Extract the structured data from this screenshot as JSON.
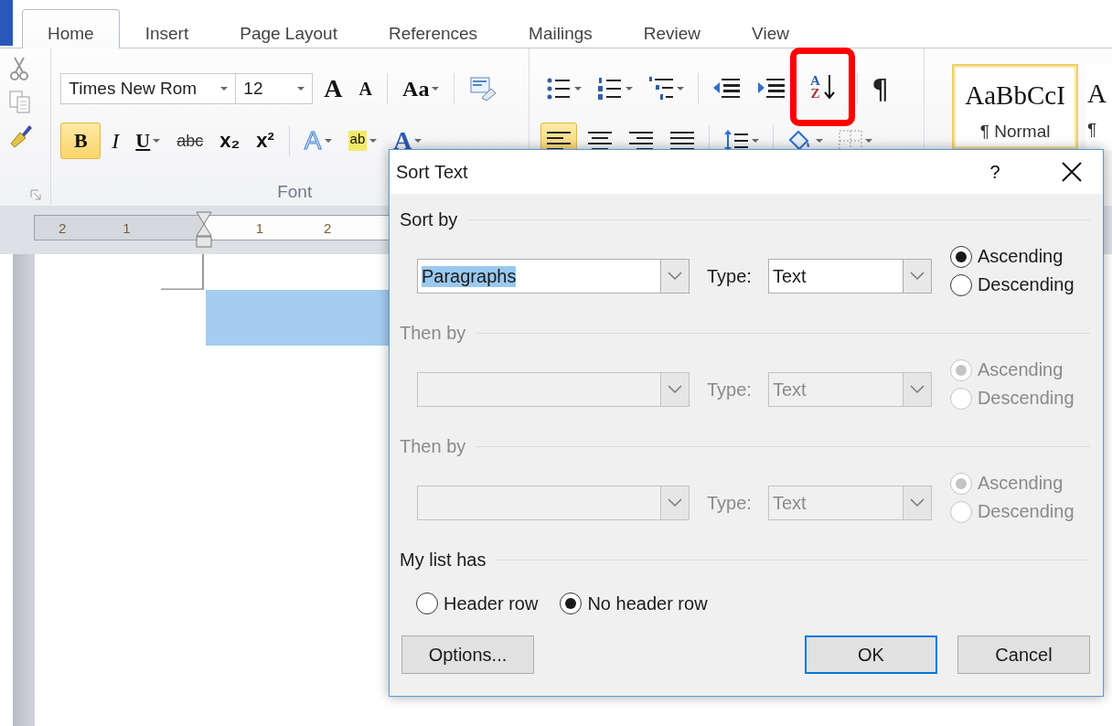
{
  "ribbon_tabs": [
    {
      "label": "Home",
      "selected": true
    },
    {
      "label": "Insert",
      "selected": false
    },
    {
      "label": "Page Layout",
      "selected": false
    },
    {
      "label": "References",
      "selected": false
    },
    {
      "label": "Mailings",
      "selected": false
    },
    {
      "label": "Review",
      "selected": false
    },
    {
      "label": "View",
      "selected": false
    }
  ],
  "font_group": {
    "label": "Font",
    "font_name": "Times New Rom",
    "font_size": "12",
    "row1": [
      {
        "kind": "grow",
        "label": "A"
      },
      {
        "kind": "shrink",
        "label": "A"
      },
      {
        "kind": "separator"
      },
      {
        "kind": "case",
        "label": "Aa"
      },
      {
        "kind": "separator"
      },
      {
        "kind": "clear"
      }
    ],
    "row2": [
      {
        "kind": "bold",
        "label": "B",
        "selected": true
      },
      {
        "kind": "italic",
        "label": "I",
        "selected": false
      },
      {
        "kind": "underline",
        "label": "U",
        "selected": false
      },
      {
        "kind": "strike",
        "label": "abc",
        "selected": false
      },
      {
        "kind": "sub",
        "label": "x₂",
        "selected": false
      },
      {
        "kind": "super",
        "label": "x²",
        "selected": false
      },
      {
        "kind": "separator"
      },
      {
        "kind": "effects",
        "label": "A"
      },
      {
        "kind": "highlight",
        "label": "ab"
      },
      {
        "kind": "color",
        "label": "A"
      }
    ]
  },
  "paragraph_group": {
    "row1": [
      {
        "kind": "bullets"
      },
      {
        "kind": "numbering"
      },
      {
        "kind": "multilevel"
      },
      {
        "kind": "separator"
      },
      {
        "kind": "outdent"
      },
      {
        "kind": "indent"
      },
      {
        "kind": "sort",
        "top": "A",
        "bottom": "Z",
        "highlighted": true
      },
      {
        "kind": "separator"
      },
      {
        "kind": "pilcrow",
        "label": "¶"
      }
    ],
    "row2": [
      {
        "kind": "align-left",
        "selected": true
      },
      {
        "kind": "align-center",
        "selected": false
      },
      {
        "kind": "align-right",
        "selected": false
      },
      {
        "kind": "justify",
        "selected": false
      },
      {
        "kind": "separator"
      },
      {
        "kind": "spacing"
      },
      {
        "kind": "separator"
      },
      {
        "kind": "shading"
      },
      {
        "kind": "borders"
      }
    ]
  },
  "styles": [
    {
      "sample": "AaBbCcI",
      "name": "¶ Normal",
      "selected": true
    },
    {
      "sample": "A",
      "name": "¶",
      "selected": false
    }
  ],
  "ruler": {
    "numbers": [
      "2",
      "1",
      "1",
      "2"
    ]
  },
  "dialog": {
    "title": "Sort Text",
    "help": "?",
    "criteria": [
      {
        "heading": "Sort by",
        "field": "Paragraphs",
        "text_selected": true,
        "type_label": "Type:",
        "type": "Text",
        "disabled": false,
        "orders": [
          {
            "label": "Ascending",
            "selected": true
          },
          {
            "label": "Descending",
            "selected": false
          }
        ]
      },
      {
        "heading": "Then by",
        "type_label": "Type:",
        "type": "Text",
        "disabled": true,
        "orders": [
          {
            "label": "Ascending",
            "selected": true
          },
          {
            "label": "Descending",
            "selected": false
          }
        ]
      },
      {
        "heading": "Then by",
        "type_label": "Type:",
        "type": "Text",
        "disabled": true,
        "orders": [
          {
            "label": "Ascending",
            "selected": true
          },
          {
            "label": "Descending",
            "selected": false
          }
        ]
      }
    ],
    "list_has": {
      "heading": "My list has",
      "options": [
        {
          "label": "Header row",
          "selected": false
        },
        {
          "label": "No header row",
          "selected": true
        }
      ]
    },
    "buttons": [
      {
        "label": "Options...",
        "default": false
      },
      {
        "label": "OK",
        "default": true
      },
      {
        "label": "Cancel",
        "default": false
      }
    ]
  }
}
